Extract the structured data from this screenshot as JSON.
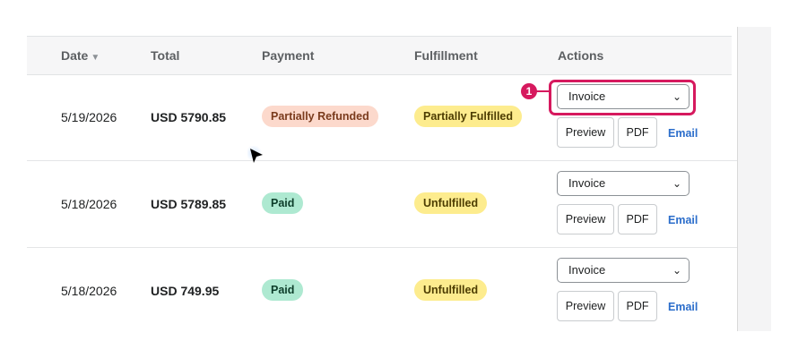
{
  "table": {
    "headers": {
      "date": "Date",
      "sort_indicator": "▼",
      "total": "Total",
      "payment": "Payment",
      "fulfillment": "Fulfillment",
      "actions": "Actions"
    },
    "rows": [
      {
        "date": "5/19/2026",
        "total": "USD 5790.85",
        "payment": "Partially Refunded",
        "fulfillment": "Partially Fulfilled",
        "document_select": "Invoice",
        "preview": "Preview",
        "pdf": "PDF",
        "email": "Email"
      },
      {
        "date": "5/18/2026",
        "total": "USD 5789.85",
        "payment": "Paid",
        "fulfillment": "Unfulfilled",
        "document_select": "Invoice",
        "preview": "Preview",
        "pdf": "PDF",
        "email": "Email"
      },
      {
        "date": "5/18/2026",
        "total": "USD 749.95",
        "payment": "Paid",
        "fulfillment": "Unfulfilled",
        "document_select": "Invoice",
        "preview": "Preview",
        "pdf": "PDF",
        "email": "Email"
      }
    ]
  },
  "annotation": {
    "marker_number": "1",
    "color": "#d6195e"
  },
  "colors": {
    "partially_refunded": "#fcd9cc",
    "paid": "#aee9d1",
    "fulfillment": "#fdec8e",
    "link": "#2c6ecb"
  },
  "icons": {
    "select_chevron": "chevron-down-icon",
    "sort": "sort-desc-icon",
    "cursor": "mouse-pointer-icon"
  }
}
